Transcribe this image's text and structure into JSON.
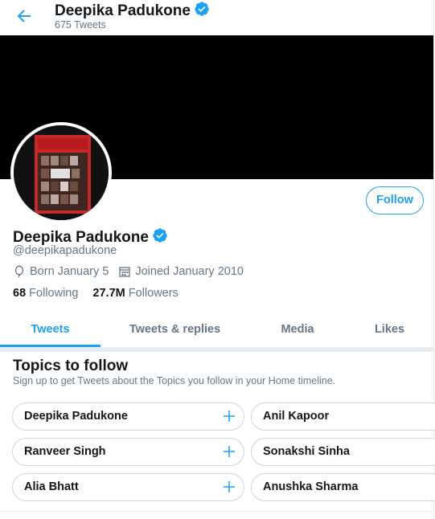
{
  "header": {
    "name": "Deepika Padukone",
    "tweet_count": "675 Tweets"
  },
  "profile": {
    "name": "Deepika Padukone",
    "handle": "@deepikapadukone",
    "born": "Born January 5",
    "joined": "Joined January 2010",
    "following_count": "68",
    "following_label": "Following",
    "followers_count": "27.7M",
    "followers_label": "Followers",
    "follow_button": "Follow"
  },
  "tabs": [
    {
      "label": "Tweets",
      "active": true
    },
    {
      "label": "Tweets & replies",
      "active": false
    },
    {
      "label": "Media",
      "active": false
    },
    {
      "label": "Likes",
      "active": false
    }
  ],
  "topics": {
    "title": "Topics to follow",
    "subtitle": "Sign up to get Tweets about the Topics you follow in your Home timeline.",
    "items": [
      {
        "label": "Deepika Padukone"
      },
      {
        "label": "Anil Kapoor"
      },
      {
        "label": "Ranveer Singh"
      },
      {
        "label": "Sonakshi Sinha"
      },
      {
        "label": "Alia Bhatt"
      },
      {
        "label": "Anushka Sharma"
      }
    ]
  },
  "colors": {
    "accent": "#1da1f2",
    "muted": "#657786",
    "banner": "#000000"
  }
}
